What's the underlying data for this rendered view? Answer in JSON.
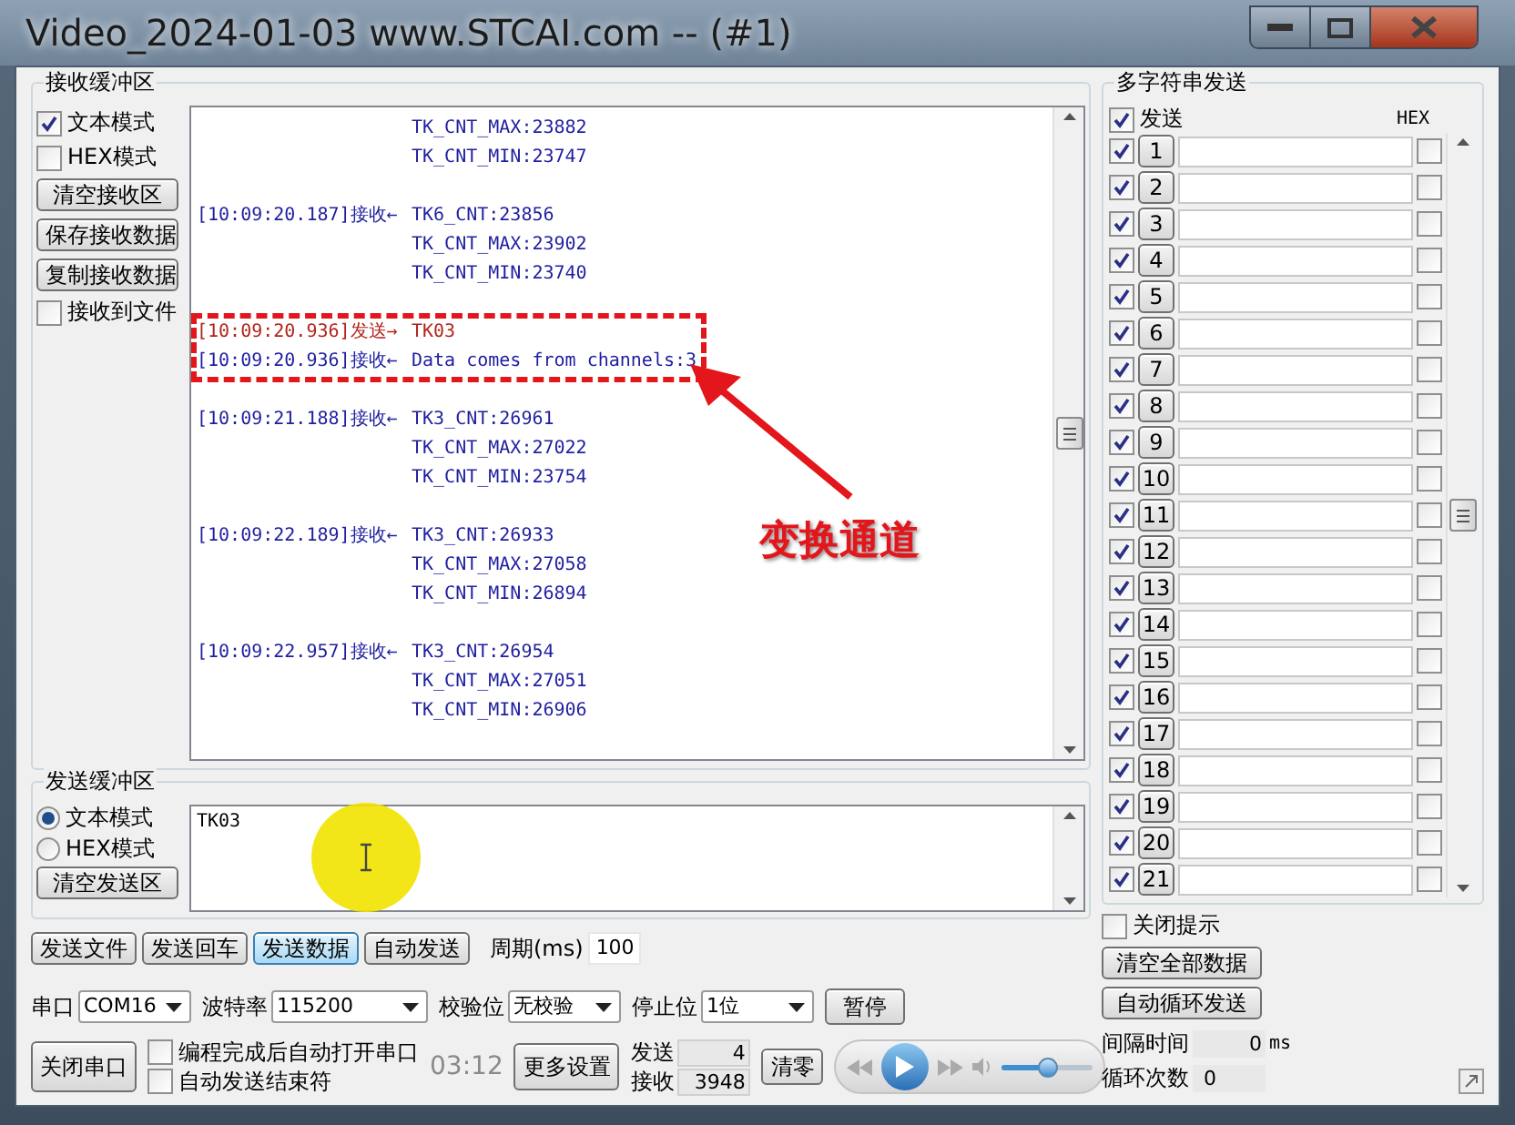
{
  "window": {
    "title": "Video_2024-01-03 www.STCAI.com -- (#1)"
  },
  "receive": {
    "title": "接收缓冲区",
    "options": [
      {
        "label": "文本模式",
        "checked": true
      },
      {
        "label": "HEX模式",
        "checked": false
      }
    ],
    "buttons": [
      "清空接收区",
      "保存接收数据",
      "复制接收数据"
    ],
    "to_file": {
      "label": "接收到文件",
      "checked": false
    },
    "log": [
      {
        "highlighted": false,
        "entries": [
          {
            "kind": "recv",
            "lines": [
              "TK_CNT_MAX:23882",
              "TK_CNT_MIN:23747"
            ]
          }
        ]
      },
      {
        "highlighted": false,
        "entries": [
          {
            "kind": "recv",
            "prefix": "[10:09:20.187]接收←",
            "lines": [
              "TK6_CNT:23856",
              "TK_CNT_MAX:23902",
              "TK_CNT_MIN:23740"
            ]
          }
        ]
      },
      {
        "highlighted": true,
        "entries": [
          {
            "kind": "send",
            "prefix": "[10:09:20.936]发送→",
            "lines": [
              "TK03"
            ]
          },
          {
            "kind": "recv",
            "prefix": "[10:09:20.936]接收←",
            "lines": [
              "Data comes from channels:3"
            ]
          }
        ]
      },
      {
        "highlighted": false,
        "entries": [
          {
            "kind": "recv",
            "prefix": "[10:09:21.188]接收←",
            "lines": [
              "TK3_CNT:26961",
              "TK_CNT_MAX:27022",
              "TK_CNT_MIN:23754"
            ]
          }
        ]
      },
      {
        "highlighted": false,
        "entries": [
          {
            "kind": "recv",
            "prefix": "[10:09:22.189]接收←",
            "lines": [
              "TK3_CNT:26933",
              "TK_CNT_MAX:27058",
              "TK_CNT_MIN:26894"
            ]
          }
        ]
      },
      {
        "highlighted": false,
        "entries": [
          {
            "kind": "recv",
            "prefix": "[10:09:22.957]接收←",
            "lines": [
              "TK3_CNT:26954",
              "TK_CNT_MAX:27051",
              "TK_CNT_MIN:26906"
            ]
          }
        ]
      }
    ],
    "annotation": "变换通道"
  },
  "send": {
    "title": "发送缓冲区",
    "options": [
      {
        "label": "文本模式",
        "selected": true
      },
      {
        "label": "HEX模式",
        "selected": false
      }
    ],
    "clear_button": "清空发送区",
    "text": "TK03"
  },
  "send_buttons": [
    {
      "label": "发送文件",
      "selected": false
    },
    {
      "label": "发送回车",
      "selected": false
    },
    {
      "label": "发送数据",
      "selected": true
    },
    {
      "label": "自动发送",
      "selected": false
    }
  ],
  "period": {
    "label": "周期(ms)",
    "value": "100"
  },
  "settings": [
    {
      "label": "串口",
      "value": "COM16"
    },
    {
      "label": "波特率",
      "value": "115200"
    },
    {
      "label": "校验位",
      "value": "无校验"
    },
    {
      "label": "停止位",
      "value": "1位"
    }
  ],
  "pause_button": "暂停",
  "close_port": "关闭串口",
  "bottom_checks": [
    {
      "label": "编程完成后自动打开串口",
      "checked": false
    },
    {
      "label": "自动发送结束符",
      "checked": false
    }
  ],
  "more_settings": "更多设置",
  "counts": [
    {
      "label": "发送",
      "value": "4"
    },
    {
      "label": "接收",
      "value": "3948"
    }
  ],
  "clear_counts": "清零",
  "player": {
    "time": "03:12",
    "volume": {
      "level": 0.5
    }
  },
  "multi": {
    "title": "多字符串发送",
    "send_all": {
      "label": "发送",
      "checked": true
    },
    "hex_header": "HEX",
    "rows": [
      {
        "label": "1",
        "checked": true,
        "hex": false
      },
      {
        "label": "2",
        "checked": true,
        "hex": false
      },
      {
        "label": "3",
        "checked": true,
        "hex": false
      },
      {
        "label": "4",
        "checked": true,
        "hex": false
      },
      {
        "label": "5",
        "checked": true,
        "hex": false
      },
      {
        "label": "6",
        "checked": true,
        "hex": false
      },
      {
        "label": "7",
        "checked": true,
        "hex": false
      },
      {
        "label": "8",
        "checked": true,
        "hex": false
      },
      {
        "label": "9",
        "checked": true,
        "hex": false
      },
      {
        "label": "10",
        "checked": true,
        "hex": false
      },
      {
        "label": "11",
        "checked": true,
        "hex": false
      },
      {
        "label": "12",
        "checked": true,
        "hex": false
      },
      {
        "label": "13",
        "checked": true,
        "hex": false
      },
      {
        "label": "14",
        "checked": true,
        "hex": false
      },
      {
        "label": "15",
        "checked": true,
        "hex": false
      },
      {
        "label": "16",
        "checked": true,
        "hex": false
      },
      {
        "label": "17",
        "checked": true,
        "hex": false
      },
      {
        "label": "18",
        "checked": true,
        "hex": false
      },
      {
        "label": "19",
        "checked": true,
        "hex": false
      },
      {
        "label": "20",
        "checked": true,
        "hex": false
      },
      {
        "label": "21",
        "checked": true,
        "hex": false
      }
    ],
    "close_tips": {
      "label": "关闭提示",
      "checked": false
    },
    "buttons": [
      "清空全部数据",
      "自动循环发送"
    ],
    "interval": {
      "label": "间隔时间",
      "value": "0",
      "unit": "ms"
    },
    "loop": {
      "label": "循环次数",
      "value": "0"
    }
  }
}
